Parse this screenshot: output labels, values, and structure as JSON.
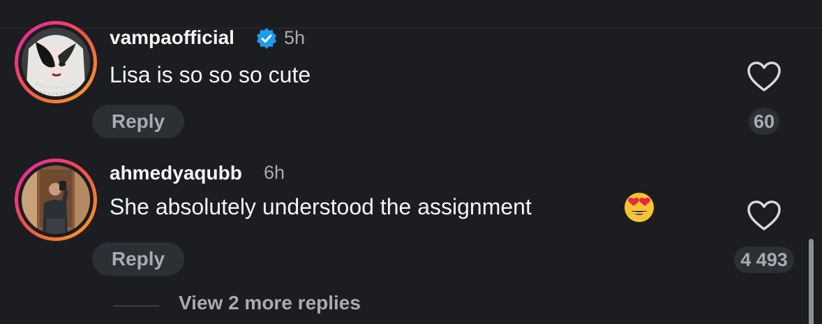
{
  "comments": [
    {
      "username": "vampaofficial",
      "verified": true,
      "time": "5h",
      "text": "Lisa is so so so cute",
      "reply_label": "Reply",
      "likes": "60",
      "avatar": "woman-dark-makeup-avatar"
    },
    {
      "username": "ahmedyaqubb",
      "verified": false,
      "time": "6h",
      "text": "She absolutely understood the assignment",
      "emoji": "😍",
      "reply_label": "Reply",
      "likes": "4 493",
      "avatar": "man-mirror-selfie-avatar"
    }
  ],
  "view_more_replies": "View 2 more replies",
  "colors": {
    "background": "#1b1d20",
    "text_primary": "#f5f5f5",
    "text_secondary": "#a8abb1",
    "pill": "#2c2f34",
    "verified": "#1d9bf0",
    "story_ring_start": "#e61fb6",
    "story_ring_end": "#f7a51e"
  }
}
